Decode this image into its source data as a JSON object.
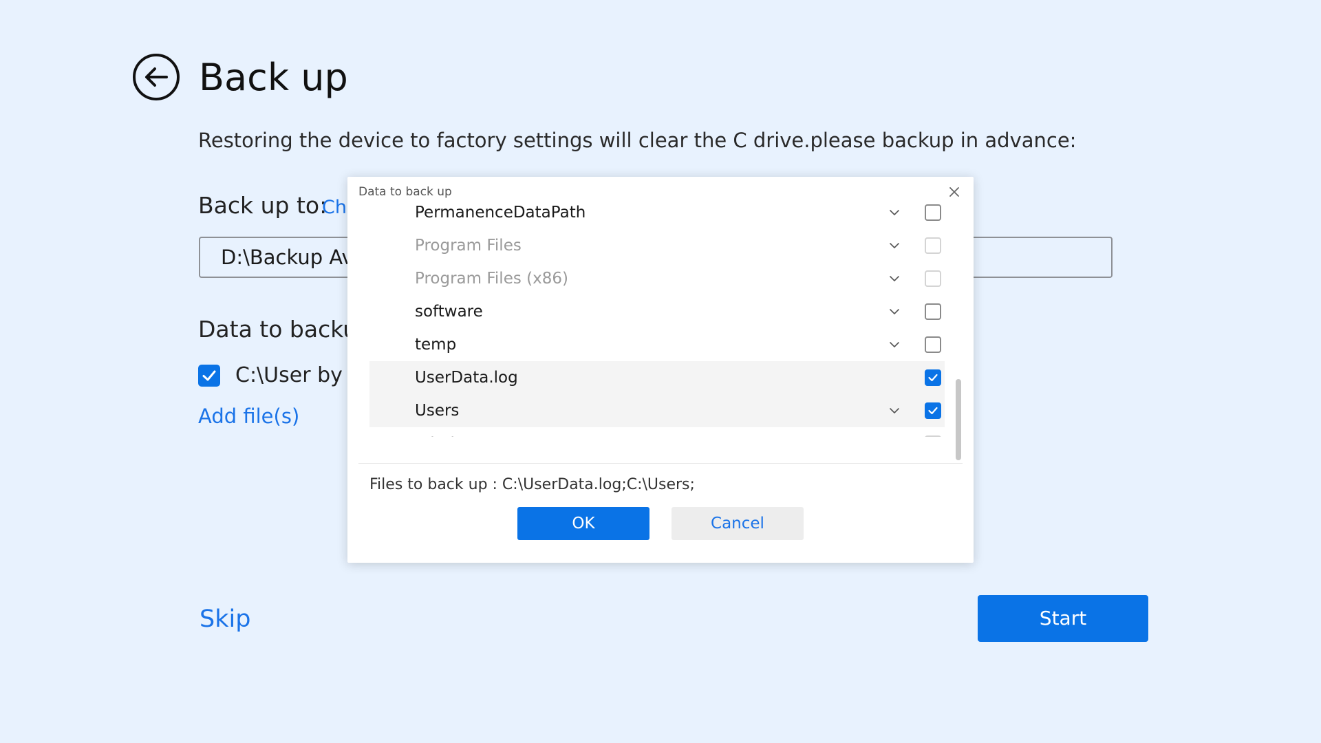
{
  "header": {
    "title": "Back up",
    "back_icon": "back-arrow-circle-icon"
  },
  "main": {
    "description": "Restoring the device to factory settings will clear the C drive.please backup in advance:",
    "backup_to_label": "Back up to:",
    "change_link": "Ch",
    "path_value": "D:\\Backup Ava",
    "data_label": "Data to backu",
    "default_item": {
      "label": "C:\\User by d",
      "checked": true
    },
    "add_files": "Add file(s)"
  },
  "footer": {
    "skip": "Skip",
    "start": "Start"
  },
  "dialog": {
    "title": "Data to back up",
    "close_icon": "close-icon",
    "items": [
      {
        "name": "PermanenceDataPath",
        "expandable": true,
        "checked": false,
        "disabled": false,
        "highlighted": false
      },
      {
        "name": "Program Files",
        "expandable": true,
        "checked": false,
        "disabled": true,
        "highlighted": false
      },
      {
        "name": "Program Files (x86)",
        "expandable": true,
        "checked": false,
        "disabled": true,
        "highlighted": false
      },
      {
        "name": "software",
        "expandable": true,
        "checked": false,
        "disabled": false,
        "highlighted": false
      },
      {
        "name": "temp",
        "expandable": true,
        "checked": false,
        "disabled": false,
        "highlighted": false
      },
      {
        "name": "UserData.log",
        "expandable": false,
        "checked": true,
        "disabled": false,
        "highlighted": true
      },
      {
        "name": "Users",
        "expandable": true,
        "checked": true,
        "disabled": false,
        "highlighted": true
      },
      {
        "name": "Windows",
        "expandable": true,
        "checked": false,
        "disabled": true,
        "highlighted": false
      }
    ],
    "files_to_back_up": "Files to back up : C:\\UserData.log;C:\\Users;",
    "ok_label": "OK",
    "cancel_label": "Cancel"
  },
  "colors": {
    "background": "#e8f2fe",
    "accent": "#0a73e6",
    "link": "#1a73e8"
  }
}
